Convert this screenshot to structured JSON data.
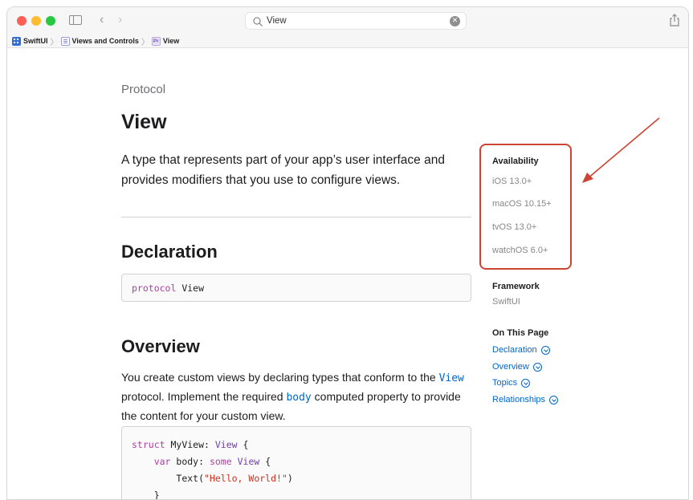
{
  "toolbar": {
    "search": {
      "value": "View"
    }
  },
  "breadcrumb": [
    {
      "label": "SwiftUI",
      "icon": "swift-framework-icon"
    },
    {
      "label": "Views and Controls",
      "icon": "document-list-icon"
    },
    {
      "label": "View",
      "icon": "protocol-icon",
      "icon_text": "Pr"
    }
  ],
  "page": {
    "eyebrow": "Protocol",
    "title": "View",
    "abstract": "A type that represents part of your app’s user interface and provides modifiers that you use to configure views."
  },
  "declaration": {
    "heading": "Declaration",
    "keyword": "protocol",
    "name": "View"
  },
  "overview": {
    "heading": "Overview",
    "text_1": "You create custom views by declaring types that conform to the ",
    "link_1": "View",
    "text_2": " protocol. Implement the required ",
    "link_2": "body",
    "text_3": " computed property to provide the content for your custom view."
  },
  "example_code": {
    "l1_kw": "struct",
    "l1_name": " MyView: ",
    "l1_type": "View",
    "l1_end": " {",
    "l2_indent": "    ",
    "l2_kw": "var",
    "l2_name": " body: ",
    "l2_kw2": "some",
    "l2_sp": " ",
    "l2_type": "View",
    "l2_end": " {",
    "l3_indent": "        ",
    "l3_func": "Text(",
    "l3_str": "\"Hello, World!\"",
    "l3_end": ")",
    "l4": "    }",
    "l5": "}"
  },
  "rail": {
    "availability_heading": "Availability",
    "availability": [
      "iOS 13.0+",
      "macOS 10.15+",
      "tvOS 13.0+",
      "watchOS 6.0+"
    ],
    "framework_heading": "Framework",
    "framework": "SwiftUI",
    "on_this_page_heading": "On This Page",
    "on_this_page": [
      "Declaration",
      "Overview",
      "Topics",
      "Relationships"
    ]
  },
  "colors": {
    "link": "#0066cc",
    "annotation": "#cc4433",
    "keyword": "#ad3da4",
    "string": "#d12f1b"
  }
}
